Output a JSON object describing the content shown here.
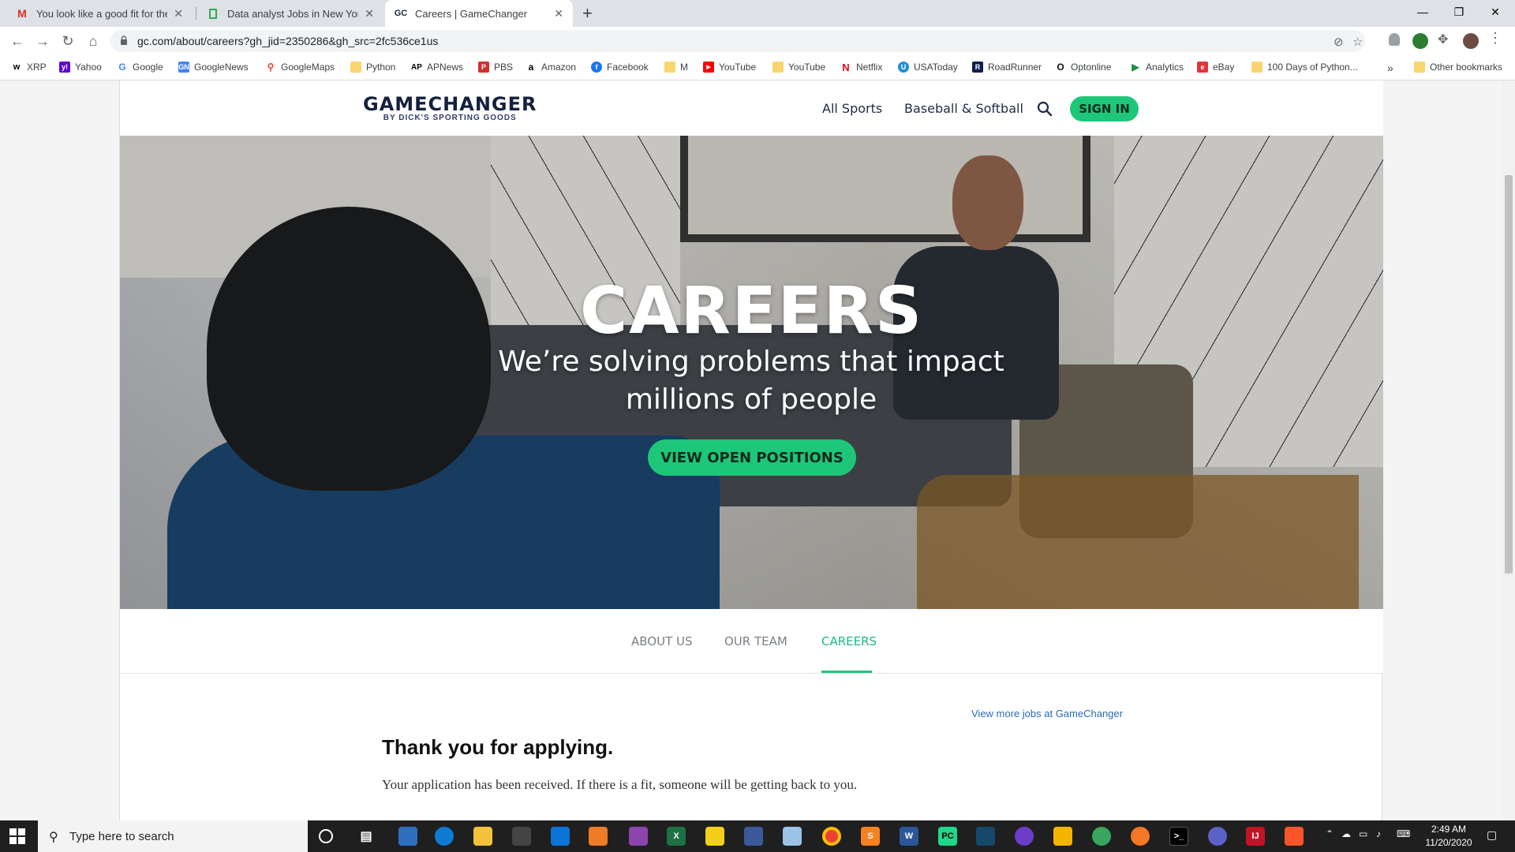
{
  "browser": {
    "tabs": [
      {
        "title": "You look like a good fit for the jo",
        "favicon": "gmail-icon",
        "active": false
      },
      {
        "title": "Data analyst Jobs in New York, N",
        "favicon": "sheets-icon",
        "active": false
      },
      {
        "title": "Careers | GameChanger",
        "favicon": "gc-icon",
        "favicon_text": "GC",
        "active": true
      }
    ],
    "new_tab": "+",
    "url": "gc.com/about/careers?gh_jid=2350286&gh_src=2fc536ce1us",
    "bookmarks": [
      {
        "label": "XRP",
        "color": "#000000",
        "icon_text": "w"
      },
      {
        "label": "Yahoo",
        "color": "#5f01d1",
        "icon_text": "y!"
      },
      {
        "label": "Google",
        "color": "#4285f4",
        "icon_text": "G"
      },
      {
        "label": "GoogleNews",
        "color": "#4285f4",
        "icon_text": "GN"
      },
      {
        "label": "GoogleMaps",
        "color": "#34a853",
        "icon_text": "M"
      },
      {
        "label": "Python",
        "color": "#f9d56e",
        "icon_text": ""
      },
      {
        "label": "APNews",
        "color": "#000000",
        "icon_text": "AP"
      },
      {
        "label": "PBS",
        "color": "#d32f2f",
        "icon_text": "P"
      },
      {
        "label": "Amazon",
        "color": "#000000",
        "icon_text": "a"
      },
      {
        "label": "Facebook",
        "color": "#1877f2",
        "icon_text": "f"
      },
      {
        "label": "M",
        "color": "#f9d56e",
        "icon_text": ""
      },
      {
        "label": "YouTube",
        "color": "#ff0000",
        "icon_text": "▶"
      },
      {
        "label": "YouTube",
        "color": "#f9d56e",
        "icon_text": ""
      },
      {
        "label": "Netflix",
        "color": "#e50914",
        "icon_text": "N"
      },
      {
        "label": "USAToday",
        "color": "#1f8fd6",
        "icon_text": "U"
      },
      {
        "label": "RoadRunner",
        "color": "#0b1f4a",
        "icon_text": "R"
      },
      {
        "label": "Optonline",
        "color": "#111111",
        "icon_text": "O"
      },
      {
        "label": "Analytics",
        "color": "#1e8e3e",
        "icon_text": "▶"
      },
      {
        "label": "eBay",
        "color": "#e53238",
        "icon_text": "e"
      },
      {
        "label": "100 Days of Python...",
        "color": "#f9d56e",
        "icon_text": ""
      }
    ],
    "bookmarks_more": "»",
    "other_bookmarks": "Other bookmarks"
  },
  "site": {
    "logo_main": "GAMECHANGER",
    "logo_sub": "BY DICK'S SPORTING GOODS",
    "nav": [
      "All Sports",
      "Baseball & Softball"
    ],
    "signin": "SIGN IN",
    "hero_title": "CAREERS",
    "hero_subtitle": "We’re solving problems that impact millions of people",
    "hero_button": "VIEW OPEN POSITIONS",
    "subnav": [
      "ABOUT US",
      "OUR TEAM",
      "CAREERS"
    ],
    "subnav_active": "CAREERS",
    "more_jobs_link": "View more jobs at GameChanger",
    "thankyou_heading": "Thank you for applying.",
    "received_text": "Your application has been received. If there is a fit, someone will be getting back to you.",
    "brand_color": "#1ec67a",
    "logo_color": "#14213d"
  },
  "taskbar": {
    "search_placeholder": "Type here to search",
    "time": "2:49 AM",
    "date": "11/20/2020"
  }
}
